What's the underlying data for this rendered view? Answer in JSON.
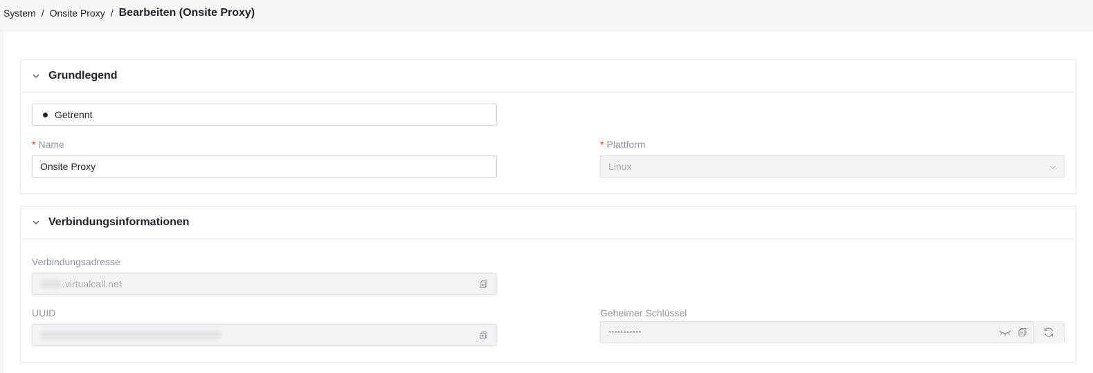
{
  "breadcrumb": {
    "items": [
      "System",
      "Onsite Proxy"
    ],
    "separator": "/",
    "current": "Bearbeiten (Onsite Proxy)"
  },
  "section_basic": {
    "title": "Grundlegend",
    "status": "Getrennt",
    "name_label": "Name",
    "name_value": "Onsite Proxy",
    "platform_label": "Plattform",
    "platform_value": "Linux",
    "required_mark": "*"
  },
  "section_connection": {
    "title": "Verbindungsinformationen",
    "address_label": "Verbindungsadresse",
    "address_value": ".virtualcall.net",
    "uuid_label": "UUID",
    "secret_label": "Geheimer Schlüssel",
    "secret_value": "•••••••••••"
  },
  "icons": {
    "collapse": "chevron-down-icon",
    "copy": "copy-icon",
    "eye": "eye-closed-icon",
    "refresh": "refresh-icon",
    "select": "chevron-down-icon"
  },
  "colors": {
    "required": "#e02e24",
    "label": "#8f959e",
    "text": "#1f2329",
    "disabled_bg": "#f2f3f5"
  }
}
